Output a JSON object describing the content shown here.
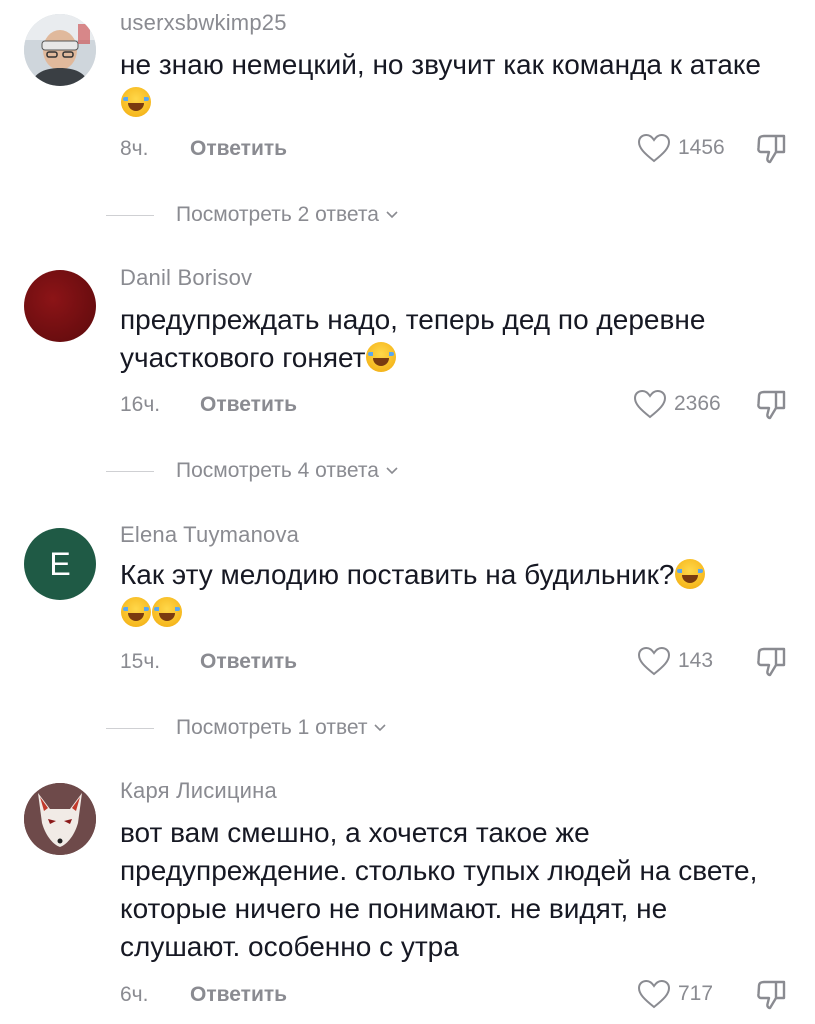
{
  "reply_label": "Ответить",
  "comments": [
    {
      "username": "userxsbwkimp25",
      "text": "не знаю немецкий, но звучит как команда к атаке",
      "emoji_count": 1,
      "time": "8ч.",
      "likes": "1456",
      "view_replies": "Посмотреть 2 ответа",
      "avatar_icon": "photo"
    },
    {
      "username": "Danil Borisov",
      "text": "предупреждать надо, теперь дед по деревне участкового гоняет",
      "emoji_count": 1,
      "time": "16ч.",
      "likes": "2366",
      "view_replies": "Посмотреть 4 ответа",
      "avatar_color": "#6b0d10"
    },
    {
      "username": "Elena Tuymanova",
      "text": "Как эту мелодию поставить на будильник?",
      "emoji_count": 3,
      "time": "15ч.",
      "likes": "143",
      "view_replies": "Посмотреть 1 ответ",
      "avatar_letter": "E",
      "avatar_color": "#1f5a45"
    },
    {
      "username": "Каря Лисицина",
      "text": "вот вам смешно, а хочется такое же предупреждение. столько тупых людей на свете, которые ничего не понимают. не видят, не слушают. особенно с утра",
      "emoji_count": 0,
      "time": "6ч.",
      "likes": "717",
      "avatar_icon": "fox-mask"
    }
  ]
}
